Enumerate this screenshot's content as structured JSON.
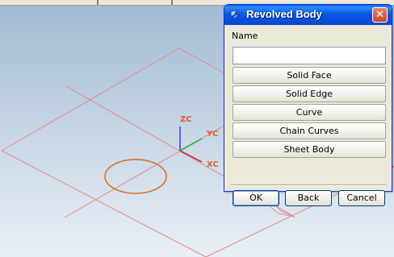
{
  "window": {
    "title": "Revolved Body",
    "close_symbol": "✕"
  },
  "form": {
    "name_label": "Name",
    "name_value": ""
  },
  "selection_buttons": [
    {
      "label": "Solid Face"
    },
    {
      "label": "Solid Edge"
    },
    {
      "label": "Curve"
    },
    {
      "label": "Chain Curves"
    },
    {
      "label": "Sheet Body"
    }
  ],
  "footer": {
    "ok_label": "OK",
    "back_label": "Back",
    "cancel_label": "Cancel"
  },
  "viewport": {
    "axes": {
      "z": "ZC",
      "y": "YC",
      "x": "XC"
    },
    "colors": {
      "z_axis": "#3a3ad0",
      "y_axis": "#2ea82e",
      "x_axis": "#d02020",
      "label": "#e05a30",
      "plane": "#e08a8a",
      "circle": "#e06a1a"
    }
  }
}
